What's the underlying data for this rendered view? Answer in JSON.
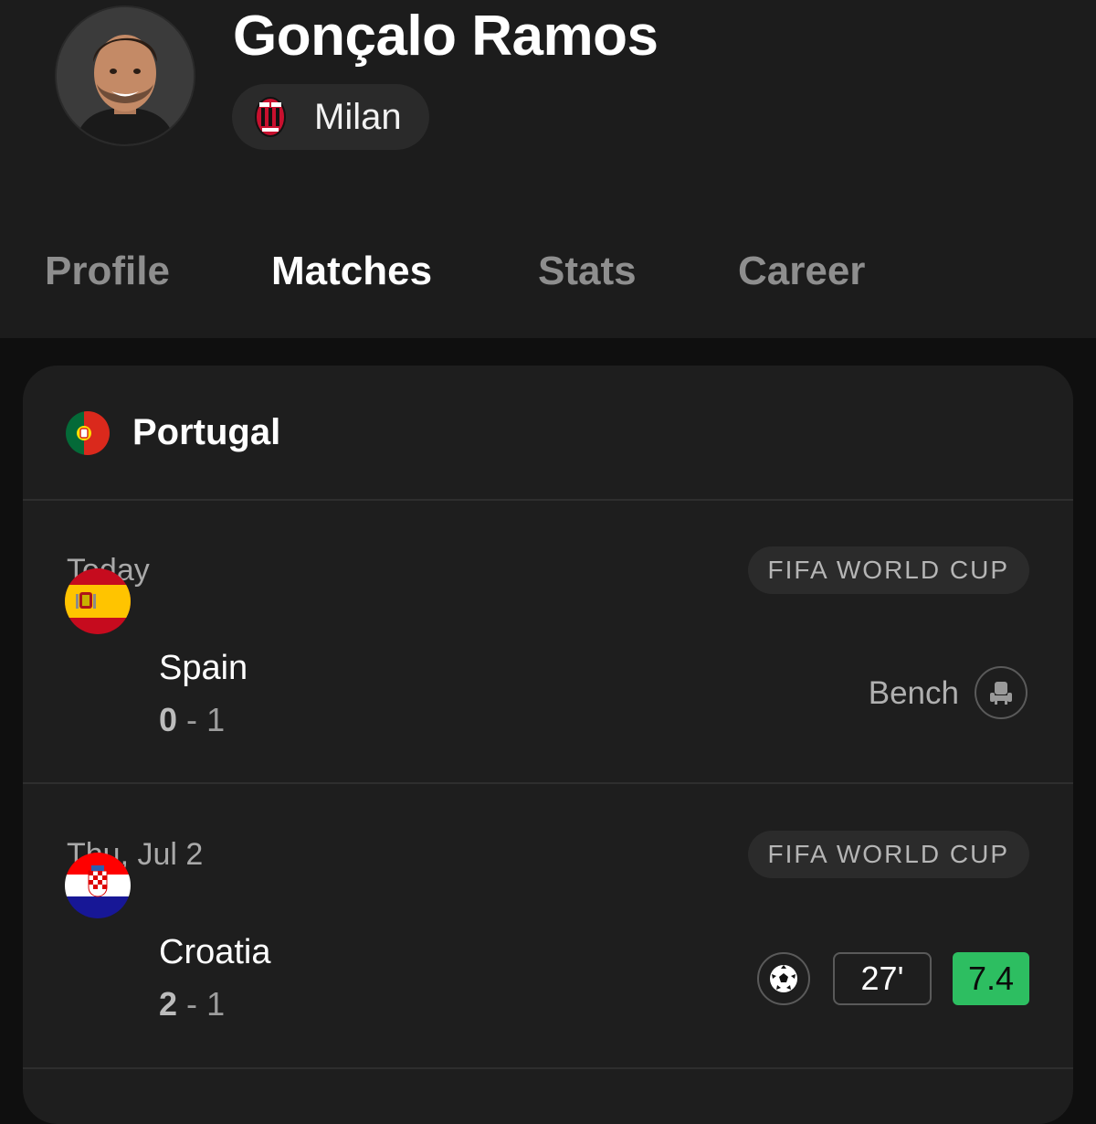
{
  "player": {
    "name": "Gonçalo Ramos",
    "club": "Milan"
  },
  "tabs": [
    {
      "label": "Profile",
      "active": false
    },
    {
      "label": "Matches",
      "active": true
    },
    {
      "label": "Stats",
      "active": false
    },
    {
      "label": "Career",
      "active": false
    }
  ],
  "team_section": {
    "team": "Portugal",
    "flag_icon": "portugal-flag-icon"
  },
  "matches": [
    {
      "date": "Today",
      "competition": "FIFA WORLD CUP",
      "opponent": "Spain",
      "opponent_flag_icon": "spain-flag-icon",
      "score_own": "0",
      "score_sep": "-",
      "score_opp": "1",
      "status": "Bench",
      "status_icon": "bench-seat-icon"
    },
    {
      "date": "Thu, Jul 2",
      "competition": "FIFA WORLD CUP",
      "opponent": "Croatia",
      "opponent_flag_icon": "croatia-flag-icon",
      "score_own": "2",
      "score_sep": "-",
      "score_opp": "1",
      "event_icon": "soccer-ball-icon",
      "minute": "27'",
      "rating": "7.4",
      "rating_color": "#2dbe61"
    }
  ]
}
